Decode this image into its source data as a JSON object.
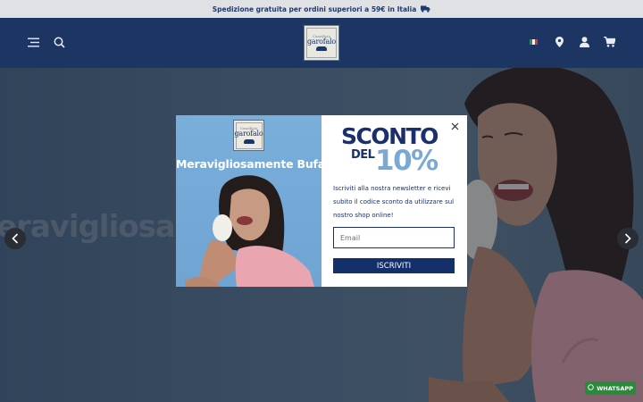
{
  "announcement": {
    "text": "Spedizione gratuita per ordini superiori a 59€ in Italia",
    "icon": "truck-icon"
  },
  "header": {
    "menu_icon": "menu-icon",
    "search_icon": "search-icon",
    "logo_text": "garofalo",
    "logo_script": "Caseificio",
    "language_flag": "italy-flag-icon",
    "store_icon": "location-pin-icon",
    "account_icon": "user-icon",
    "cart_icon": "cart-icon"
  },
  "hero": {
    "text": "eravigliosa",
    "prev_icon": "chevron-left-icon",
    "next_icon": "chevron-right-icon"
  },
  "popup": {
    "logo_text": "garofalo",
    "logo_script": "Caseificio",
    "headline": "Meravigliosamente Bufala",
    "title_line1": "SCONTO",
    "title_del": "DEL",
    "title_percent": "10%",
    "description": "Iscriviti alla nostra newsletter e ricevi subito il codice sconto da utilizzare sul nostro shop online!",
    "email_placeholder": "Email",
    "email_value": "",
    "submit_label": "ISCRIVITI",
    "close_icon": "close-icon"
  },
  "whatsapp": {
    "label": "WHATSAPP",
    "icon": "whatsapp-icon"
  },
  "colors": {
    "navy": "#1c3563",
    "popup_navy": "#13306a",
    "light_blue": "#79a9d4",
    "whatsapp_green": "#2a8a3b"
  }
}
